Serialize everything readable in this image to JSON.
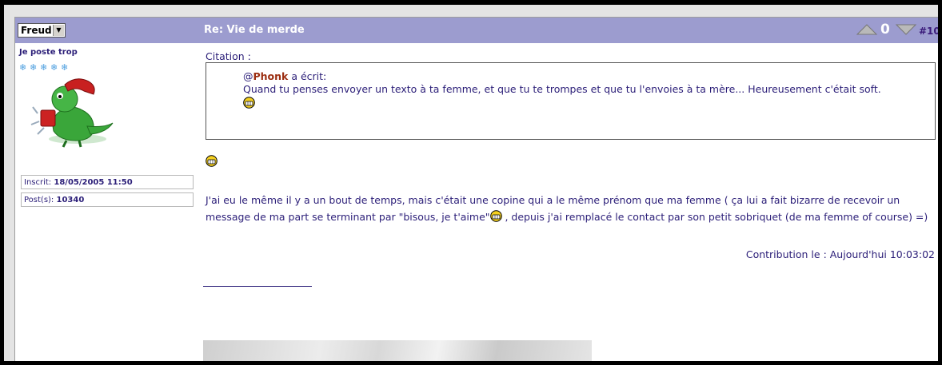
{
  "header": {
    "user_select_value": "Freud",
    "title": "Re: Vie de merde",
    "vote_count": "0",
    "post_number": "#10"
  },
  "author": {
    "rank": "Je poste trop",
    "rank_stars": 5,
    "joined_label": "Inscrit:",
    "joined_value": "18/05/2005 11:50",
    "posts_label": "Post(s):",
    "posts_value": "10340"
  },
  "quote": {
    "label": "Citation :",
    "author_prefix": "@",
    "author": "Phonk",
    "wrote": " a écrit:",
    "text": "Quand tu penses envoyer un texto à ta femme, et que tu te trompes et que tu l'envoies à ta mère... Heureusement c'était soft."
  },
  "body": {
    "text_part1": "J'ai eu le même il y a un bout de temps, mais c'était une copine qui a le même prénom que ma femme ( ça lui a fait bizarre de recevoir un message de ma part se terminant par \"bisous, je t'aime\"",
    "text_part2": " , depuis j'ai remplacé le contact par son petit sobriquet (de ma femme of course) =)",
    "contribution": "Contribution le : Aujourd'hui 10:03:02"
  },
  "icons": {
    "vote_up": "triangle-up-icon",
    "vote_down": "triangle-down-icon",
    "smiley": "grin-smiley-icon",
    "rank_star": "snowflake-icon"
  },
  "colors": {
    "header_bg": "#9c9ccf",
    "text": "#2b1e78",
    "quote_author": "#9b2d10"
  }
}
